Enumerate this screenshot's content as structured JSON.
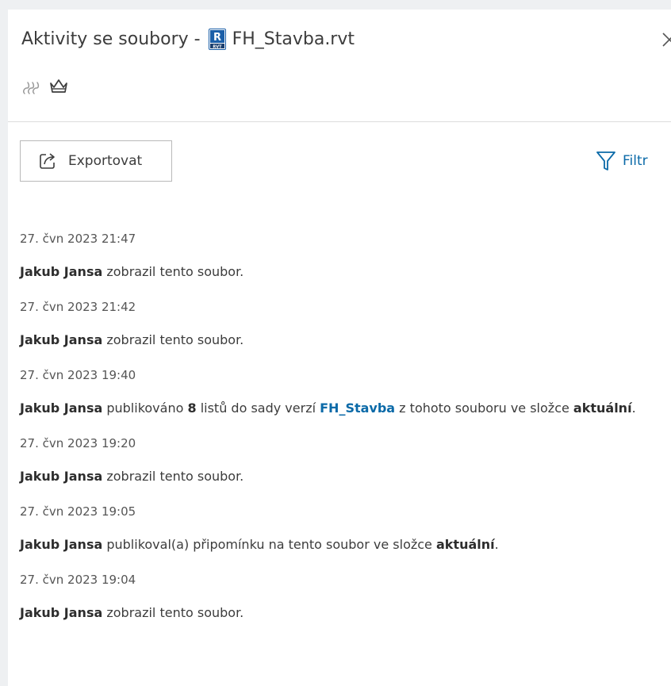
{
  "header": {
    "title_prefix": "Aktivity se soubory -",
    "file_name": "FH_Stavba.rvt",
    "file_icon_letter": "R",
    "file_icon_sub": "RVT"
  },
  "toolbar": {
    "export_label": "Exportovat",
    "filter_label": "Filtr"
  },
  "colors": {
    "accent": "#0b6aa8",
    "revit_blue": "#1b5fa8"
  },
  "activities": [
    {
      "timestamp": "27. čvn 2023 21:47",
      "user": "Jakub Jansa",
      "text": " zobrazil tento soubor."
    },
    {
      "timestamp": "27. čvn 2023 21:42",
      "user": "Jakub Jansa",
      "text": " zobrazil tento soubor."
    },
    {
      "timestamp": "27. čvn 2023 19:40",
      "user": "Jakub Jansa",
      "text_a": " publikováno ",
      "count": "8",
      "text_b": " listů do sady verzí ",
      "link": "FH_Stavba",
      "text_c": " z tohoto souboru ve složce ",
      "folder": "aktuální",
      "text_d": "."
    },
    {
      "timestamp": "27. čvn 2023 19:20",
      "user": "Jakub Jansa",
      "text": " zobrazil tento soubor."
    },
    {
      "timestamp": "27. čvn 2023 19:05",
      "user": "Jakub Jansa",
      "text_a": " publikoval(a) připomínku na tento soubor ve složce ",
      "folder": "aktuální",
      "text_b": "."
    },
    {
      "timestamp": "27. čvn 2023 19:04",
      "user": "Jakub Jansa",
      "text": " zobrazil tento soubor."
    }
  ]
}
